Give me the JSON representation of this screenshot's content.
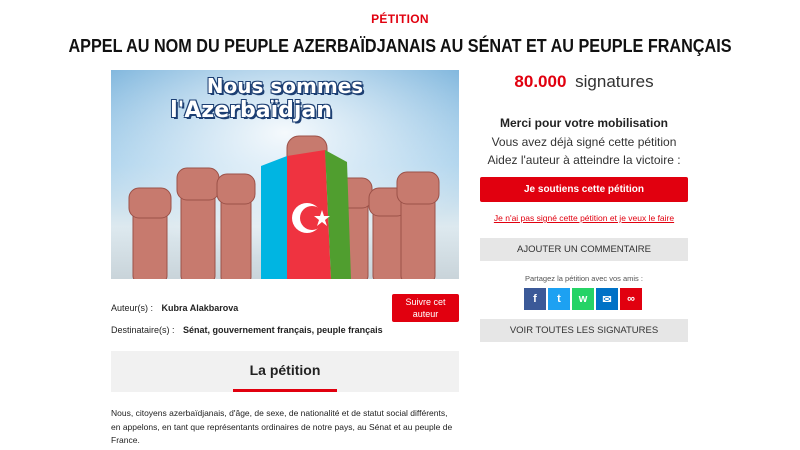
{
  "header": {
    "kicker": "PÉTITION",
    "title": "APPEL AU NOM DU PEUPLE AZERBAÏDJANAIS AU SÉNAT ET AU PEUPLE FRANÇAIS"
  },
  "hero": {
    "line1": "Nous sommes",
    "line2": "l'Azerbaïdjan"
  },
  "author": {
    "author_label": "Auteur(s) :",
    "author_name": "Kubra Alakbarova",
    "recipient_label": "Destinataire(s) :",
    "recipients": "Sénat, gouvernement français, peuple français",
    "follow_label": "Suivre cet auteur"
  },
  "petition": {
    "tab_label": "La pétition",
    "body": "Nous, citoyens azerbaïdjanais, d'âge, de sexe, de nationalité et de statut social différents, en appelons, en tant que représentants ordinaires de notre pays, au Sénat et au peuple de France."
  },
  "sidebar": {
    "signature_count": "80.000",
    "signature_label": "signatures",
    "thanks": "Merci pour votre mobilisation",
    "already_signed": "Vous avez déjà signé cette pétition",
    "help": "Aidez l'auteur à atteindre la victoire :",
    "support_button": "Je soutiens cette pétition",
    "not_signed_link": "Je n'ai pas signé cette pétition et je veux le faire",
    "comment_button": "AJOUTER UN COMMENTAIRE",
    "share_label": "Partagez la pétition avec vos amis :",
    "all_signatures_button": "VOIR TOUTES LES SIGNATURES"
  },
  "share_icons": [
    {
      "name": "facebook-icon",
      "glyph": "f",
      "color": "#3b5998"
    },
    {
      "name": "twitter-icon",
      "glyph": "t",
      "color": "#1da1f2"
    },
    {
      "name": "whatsapp-icon",
      "glyph": "w",
      "color": "#25d366"
    },
    {
      "name": "email-icon",
      "glyph": "✉",
      "color": "#0072c6"
    },
    {
      "name": "link-icon",
      "glyph": "∞",
      "color": "#e1000f"
    }
  ],
  "colors": {
    "accent": "#e1000f",
    "flag_blue": "#00b5e2",
    "flag_red": "#ef3340",
    "flag_green": "#509e2f"
  }
}
